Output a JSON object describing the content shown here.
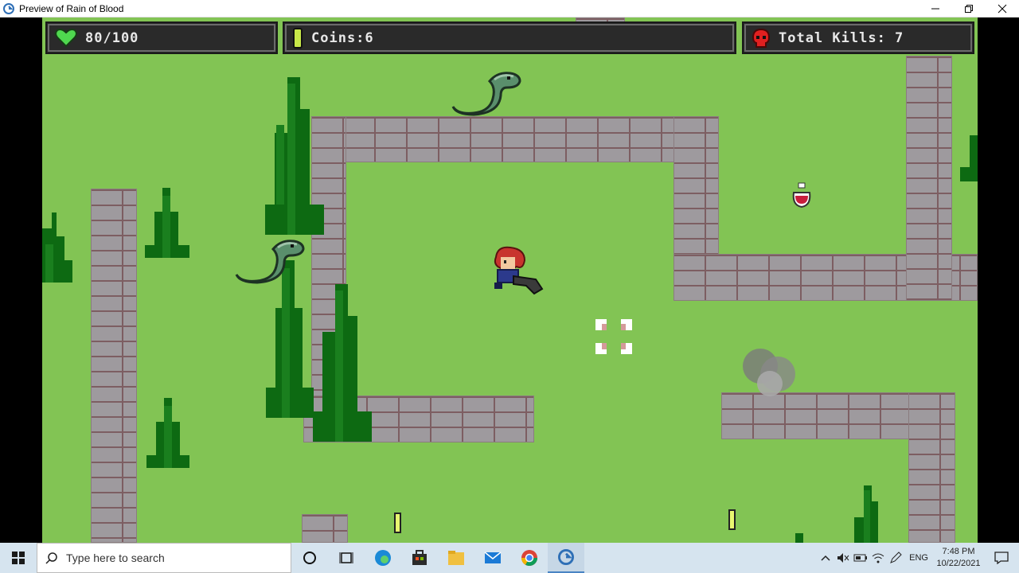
{
  "window": {
    "title": "Preview of Rain of Blood"
  },
  "hud": {
    "health": "80/100",
    "health_value": 80,
    "health_max": 100,
    "coins": "Coins:6",
    "kills": "Total Kills: 7"
  },
  "colors": {
    "grass": "#82c454",
    "wall": "#9e9a9e",
    "mortar": "#7d5e62",
    "tree_dark": "#0d6a12",
    "tree_light": "#1a7f1e",
    "hud_bg": "#2a2a2a",
    "heart": "#4fd84f",
    "coin": "#c8e848",
    "skull": "#e02020"
  },
  "taskbar": {
    "search_placeholder": "Type here to search",
    "language": "ENG",
    "time": "7:48 PM",
    "date": "10/22/2021"
  },
  "icons": {
    "hud": [
      "heart-icon",
      "coin-icon",
      "skull-icon"
    ],
    "taskbar": [
      "windows-start-icon",
      "search-icon",
      "cortana-icon",
      "task-view-icon",
      "edge-icon",
      "store-icon",
      "file-explorer-icon",
      "mail-icon",
      "chrome-icon",
      "gamemaker-icon"
    ],
    "tray": [
      "chevron-up-icon",
      "volume-muted-icon",
      "battery-icon",
      "wifi-icon",
      "pen-icon",
      "notification-icon"
    ]
  }
}
